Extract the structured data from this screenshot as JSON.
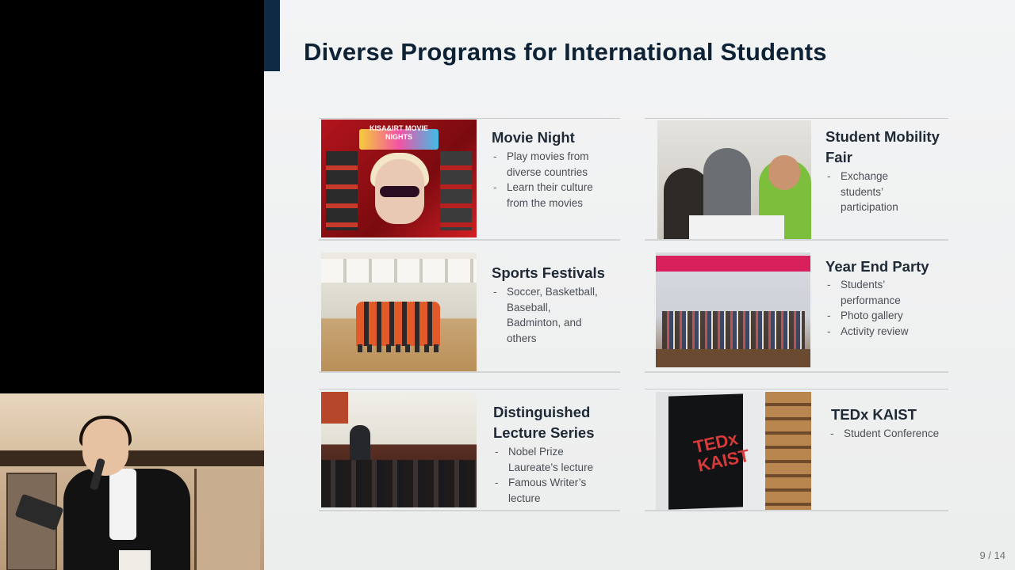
{
  "slide": {
    "title": "Diverse Programs for International Students",
    "page_number": "9 / 14",
    "accent_color": "#0f2a44",
    "programs": [
      {
        "id": "movie-night",
        "title": "Movie Night",
        "bullets": [
          "Play movies from diverse countries",
          "Learn their culture from the movies"
        ],
        "image_text": "KISA&IRT MOVIE NIGHTS"
      },
      {
        "id": "student-mobility-fair",
        "title": "Student Mobility Fair",
        "bullets": [
          "Exchange students’ participation"
        ]
      },
      {
        "id": "sports-festivals",
        "title": "Sports Festivals",
        "bullets": [
          "Soccer, Basketball, Baseball, Badminton, and others"
        ]
      },
      {
        "id": "year-end-party",
        "title": "Year End Party",
        "bullets": [
          "Students’ performance",
          "Photo gallery",
          "Activity review"
        ]
      },
      {
        "id": "distinguished-lecture-series",
        "title": "Distinguished Lecture Series",
        "bullets": [
          "Nobel Prize Laureate’s lecture",
          "Famous Writer’s lecture"
        ]
      },
      {
        "id": "tedx-kaist",
        "title": "TEDx KAIST",
        "bullets": [
          "Student Conference"
        ],
        "image_text": "TEDx KAIST"
      }
    ]
  }
}
